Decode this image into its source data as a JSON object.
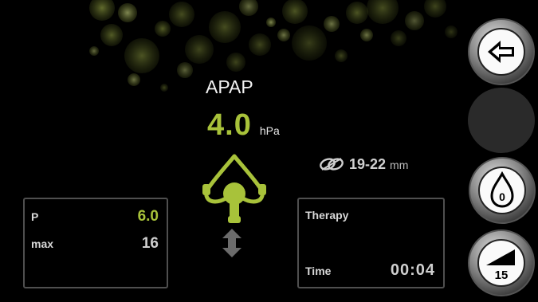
{
  "therapy_mode": "APAP",
  "pressure": {
    "value": "4.0",
    "unit": "hPa"
  },
  "mask_size": {
    "value": "19-22",
    "unit": "mm",
    "icon": "tube-link-icon"
  },
  "settings_panel": {
    "rows": [
      {
        "label": "P",
        "value": "6.0"
      },
      {
        "label": "max",
        "value": "16"
      }
    ]
  },
  "therapy_panel": {
    "title": "Therapy",
    "time_label": "Time",
    "time_value": "00:04"
  },
  "side_buttons": {
    "back_icon": "arrow-left-icon",
    "humidifier_value": "0",
    "ramp_value": "15"
  },
  "colors": {
    "accent": "#a8c23a",
    "background": "#000000",
    "panel_border": "#4f4f4f"
  }
}
